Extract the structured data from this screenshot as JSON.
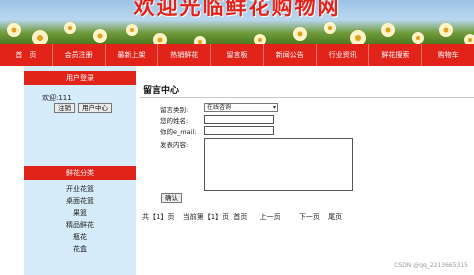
{
  "banner": {
    "title": "欢迎光临鲜花购物网"
  },
  "nav": [
    "首　页",
    "会员注册",
    "最新上架",
    "热销鲜花",
    "留言板",
    "新闻公告",
    "行业资讯",
    "鲜花搜索",
    "购物车"
  ],
  "sidebar": {
    "user_login_title": "用户登录",
    "welcome": "欢迎:111",
    "logout_label": "注销",
    "user_center_label": "用户中心",
    "categories_title": "鲜花分类",
    "categories": [
      "开业花篮",
      "桌面花篮",
      "果篮",
      "精品鲜花",
      "瓶花",
      "花盒"
    ]
  },
  "main": {
    "title": "留言中心",
    "form": {
      "type_label": "留言类别:",
      "type_value": "在线咨询",
      "name_label": "您的姓名:",
      "email_label": "你的e_mail:",
      "content_label": "发表内容:",
      "submit_label": "确认"
    },
    "pager": {
      "total": "共【1】页",
      "current": "当前第【1】页",
      "first": "首页",
      "prev": "上一页",
      "next": "下一页",
      "last": "尾页"
    }
  },
  "watermark": "CSDN @qq_2213665315"
}
